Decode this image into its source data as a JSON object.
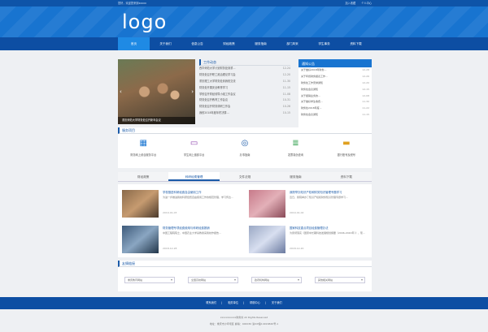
{
  "topbar": {
    "welcome": "您好，欢迎您来到xxxxx",
    "add_favorite": "加入收藏",
    "personal_center": "个人中心"
  },
  "header": {
    "logo": "logo"
  },
  "nav": {
    "items": [
      {
        "label": "首页"
      },
      {
        "label": "关于我们"
      },
      {
        "label": "信息公告"
      },
      {
        "label": "财经政策"
      },
      {
        "label": "服务指南"
      },
      {
        "label": "部门风采"
      },
      {
        "label": "学生事务"
      },
      {
        "label": "资料下载"
      }
    ]
  },
  "slider": {
    "caption": "重庆师范大学财务处召开新年会议"
  },
  "news": {
    "title": "工作动态",
    "items": [
      {
        "title": "西华师范大学计划财务处到重...",
        "date": "12-24"
      },
      {
        "title": "财务处召开职工政治理论学习会",
        "date": "12-20"
      },
      {
        "title": "重庆理工大学财务处到我校交流",
        "date": "11-30"
      },
      {
        "title": "财务处开展安全教育学习",
        "date": "11-15"
      },
      {
        "title": "学校召开财经领导小组工作会议",
        "date": "11-08"
      },
      {
        "title": "财务处召开教育工作会议",
        "date": "10-31"
      },
      {
        "title": "财务处召开财务调研工作会",
        "date": "10-26"
      },
      {
        "title": "我校2018年度年终决算...",
        "date": "10-15"
      }
    ]
  },
  "notice": {
    "title": "通知公告",
    "items": [
      {
        "title": "关于做好2018年财务...",
        "date": "12-28"
      },
      {
        "title": "关于年终财务报表工作...",
        "date": "12-26"
      },
      {
        "title": "财务处工作安排通知",
        "date": "12-20"
      },
      {
        "title": "财务处会议通知",
        "date": "12-15"
      },
      {
        "title": "关于报销业务的...",
        "date": "12-08"
      },
      {
        "title": "关于做好学生收费...",
        "date": "11-30"
      },
      {
        "title": "财务处2018年度...",
        "date": "11-22"
      },
      {
        "title": "财务处会议通知",
        "date": "11-15"
      }
    ]
  },
  "services": {
    "title": "服务项目",
    "items": [
      {
        "label": "财务网上综合服务平台",
        "icon": "chart-icon",
        "color": "#1a76d2"
      },
      {
        "label": "学生网上缴费平台",
        "icon": "monitor-icon",
        "color": "#8e44ad"
      },
      {
        "label": "办事指南",
        "icon": "compass-icon",
        "color": "#1a5aa8"
      },
      {
        "label": "发票真伪查询",
        "icon": "coins-icon",
        "color": "#2e9e4a"
      },
      {
        "label": "银行账号及税号",
        "icon": "card-icon",
        "color": "#e0a020"
      }
    ]
  },
  "tabs": {
    "items": [
      {
        "label": "财经政策"
      },
      {
        "label": "科研经费管理"
      },
      {
        "label": "文件法规"
      },
      {
        "label": "服务指南"
      },
      {
        "label": "资料下载"
      }
    ]
  },
  "articles": [
    {
      "title": "学校推进科研经费自由使用工作",
      "desc": "为进一步推进我校科研经费自由使用工作的规范管理，学习传达...",
      "date": "2019-01-03"
    },
    {
      "title": "我院举办知识产权和财务知识管理专题学习",
      "desc": "近日，我院举办了知识产权和财务知识管理专题学习...",
      "date": "2019-01-02"
    },
    {
      "title": "财务管理专项经费使用与科研经费报销",
      "desc": "中国工程院院士、中国农业大学某教授来我校作报告...",
      "date": "2018-12-28"
    },
    {
      "title": "国家科技重点项目经费管理办法",
      "desc": "为贯彻落实《国家中长期科技发展规划纲要（2006-2020年）》，现...",
      "date": "2018-12-20"
    }
  ],
  "links": {
    "title": "友情链接",
    "selects": [
      {
        "value": "重庆教育网站"
      },
      {
        "value": "全国高校网站"
      },
      {
        "value": "政府机构网站"
      },
      {
        "value": "其他相关网站"
      }
    ]
  },
  "footer_nav": {
    "items": [
      {
        "label": "联系我们"
      },
      {
        "label": "相关单位"
      },
      {
        "label": "帮助中心"
      },
      {
        "label": "关于我们"
      }
    ]
  },
  "footer": {
    "copyright": "xxxxxxxxxxx财务处 All Rights Reserved",
    "address": "地址：重庆市沙坪坝区 邮编：400030 渝ICP备14016840号-1"
  }
}
